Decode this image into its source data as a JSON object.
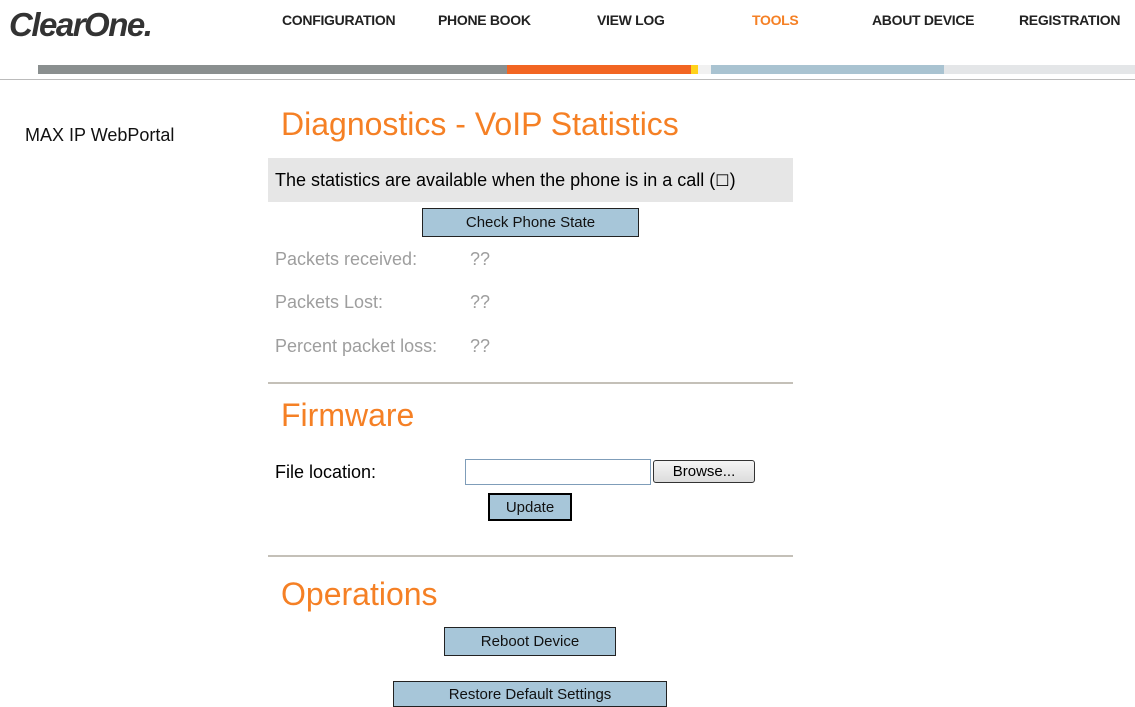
{
  "brand": {
    "logo_text": "ClearOne."
  },
  "nav": {
    "items": [
      {
        "label": "CONFIGURATION",
        "active": false
      },
      {
        "label": "PHONE BOOK",
        "active": false
      },
      {
        "label": "VIEW LOG",
        "active": false
      },
      {
        "label": "TOOLS",
        "active": true
      },
      {
        "label": "ABOUT DEVICE",
        "active": false
      },
      {
        "label": "REGISTRATION",
        "active": false
      }
    ]
  },
  "colors": {
    "accent": "#f58025",
    "stripe_gray": "#8a8f8f",
    "stripe_orange": "#f26522",
    "stripe_yellow": "#ffd21a",
    "stripe_blue": "#a9c3d1",
    "stripe_light": "#e4e6e8",
    "button_bg": "#a7c6d9"
  },
  "sidebar": {
    "title": "MAX IP WebPortal"
  },
  "diagnostics": {
    "title": "Diagnostics - VoIP Statistics",
    "notice_text": "The statistics are available when the phone is in a call",
    "check_button": "Check Phone State",
    "stats": [
      {
        "label": "Packets received:",
        "value": "??"
      },
      {
        "label": "Packets Lost:",
        "value": "??"
      },
      {
        "label": "Percent packet loss:",
        "value": "??"
      }
    ]
  },
  "firmware": {
    "title": "Firmware",
    "file_label": "File location:",
    "file_value": "",
    "browse_button": "Browse...",
    "update_button": "Update"
  },
  "operations": {
    "title": "Operations",
    "reboot_button": "Reboot Device",
    "restore_button": "Restore Default Settings"
  }
}
